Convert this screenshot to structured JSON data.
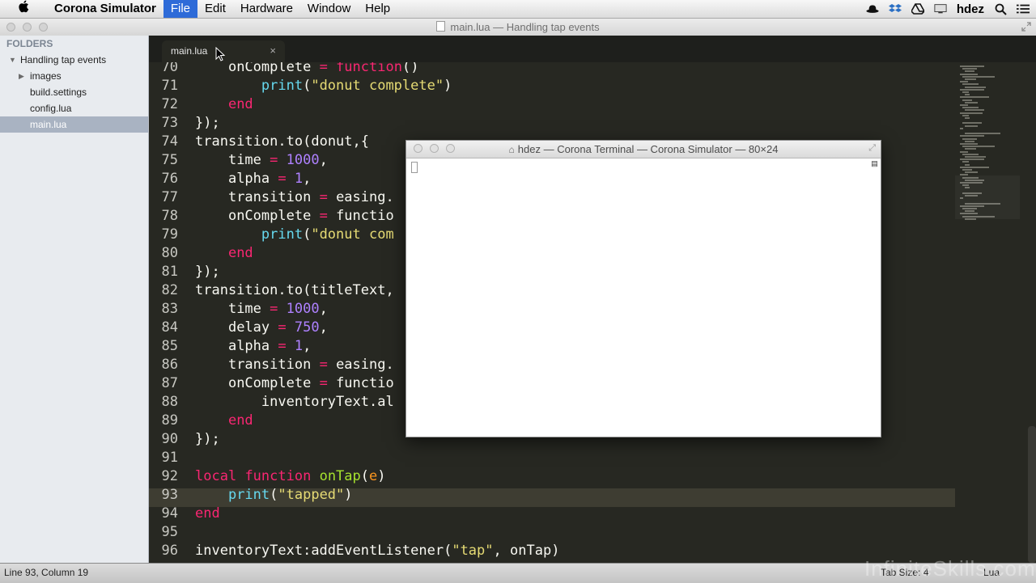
{
  "menubar": {
    "apple": "",
    "app_name": "Corona Simulator",
    "items": [
      "File",
      "Edit",
      "Hardware",
      "Window",
      "Help"
    ],
    "active_item": "File",
    "user": "hdez"
  },
  "window": {
    "title": "main.lua — Handling tap events"
  },
  "sidebar": {
    "header": "FOLDERS",
    "items": [
      {
        "label": "Handling tap events",
        "type": "folder-open"
      },
      {
        "label": "images",
        "type": "folder-closed"
      },
      {
        "label": "build.settings",
        "type": "file"
      },
      {
        "label": "config.lua",
        "type": "file"
      },
      {
        "label": "main.lua",
        "type": "file",
        "selected": true
      }
    ]
  },
  "tabs": [
    {
      "label": "main.lua",
      "close": "×"
    }
  ],
  "editor": {
    "current_line": 93,
    "lines": [
      {
        "n": "70",
        "code": "    onComplete = function()"
      },
      {
        "n": "71",
        "code": "        print(\"donut complete\")"
      },
      {
        "n": "72",
        "code": "    end"
      },
      {
        "n": "73",
        "code": "});"
      },
      {
        "n": "74",
        "code": "transition.to(donut,{"
      },
      {
        "n": "75",
        "code": "    time = 1000,"
      },
      {
        "n": "76",
        "code": "    alpha = 1,"
      },
      {
        "n": "77",
        "code": "    transition = easing."
      },
      {
        "n": "78",
        "code": "    onComplete = functio"
      },
      {
        "n": "79",
        "code": "        print(\"donut com"
      },
      {
        "n": "80",
        "code": "    end"
      },
      {
        "n": "81",
        "code": "});"
      },
      {
        "n": "82",
        "code": "transition.to(titleText,"
      },
      {
        "n": "83",
        "code": "    time = 1000,"
      },
      {
        "n": "84",
        "code": "    delay = 750,"
      },
      {
        "n": "85",
        "code": "    alpha = 1,"
      },
      {
        "n": "86",
        "code": "    transition = easing."
      },
      {
        "n": "87",
        "code": "    onComplete = functio"
      },
      {
        "n": "88",
        "code": "        inventoryText.al"
      },
      {
        "n": "89",
        "code": "    end"
      },
      {
        "n": "90",
        "code": "});"
      },
      {
        "n": "91",
        "code": ""
      },
      {
        "n": "92",
        "code": "local function onTap(e)"
      },
      {
        "n": "93",
        "code": "    print(\"tapped\")"
      },
      {
        "n": "94",
        "code": "end"
      },
      {
        "n": "95",
        "code": ""
      },
      {
        "n": "96",
        "code": "inventoryText:addEventListener(\"tap\", onTap)"
      }
    ]
  },
  "terminal": {
    "title": "hdez — Corona Terminal — Corona Simulator — 80×24"
  },
  "statusbar": {
    "position": "Line 93, Column 19",
    "tab_size": "Tab Size: 4",
    "syntax": "Lua"
  },
  "watermark": "InfiniteSkills.com",
  "colors": {
    "editor_bg": "#272822",
    "keyword": "#f92672",
    "function_name": "#a6e22e",
    "number": "#ae81ff",
    "string": "#e6db74",
    "builtin": "#66d9ef",
    "param": "#fd971f",
    "menu_active": "#2e6bd8"
  }
}
